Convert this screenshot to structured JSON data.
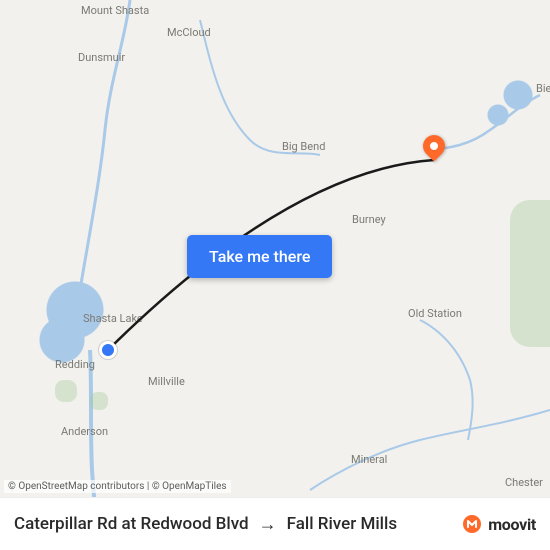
{
  "map": {
    "labels": {
      "mtshasta": "Mount Shasta",
      "mccloud": "McCloud",
      "dunsmuir": "Dunsmuir",
      "bigbend": "Big Bend",
      "burney": "Burney",
      "shasta": "Shasta Lake",
      "oldstat": "Old Station",
      "redding": "Redding",
      "millvil": "Millville",
      "anderson": "Anderson",
      "mineral": "Mineral",
      "chester": "Chester",
      "bie": "Bie"
    },
    "pins": {
      "origin_name": "origin-pin",
      "dest_name": "destination-pin"
    },
    "cta_label": "Take me there",
    "attribution": {
      "osm": "© OpenStreetMap contributors",
      "omt": "© OpenMapTiles",
      "sep": " | "
    }
  },
  "footer": {
    "from": "Caterpillar Rd at Redwood Blvd",
    "to": "Fall River Mills",
    "brand": "moovit"
  }
}
